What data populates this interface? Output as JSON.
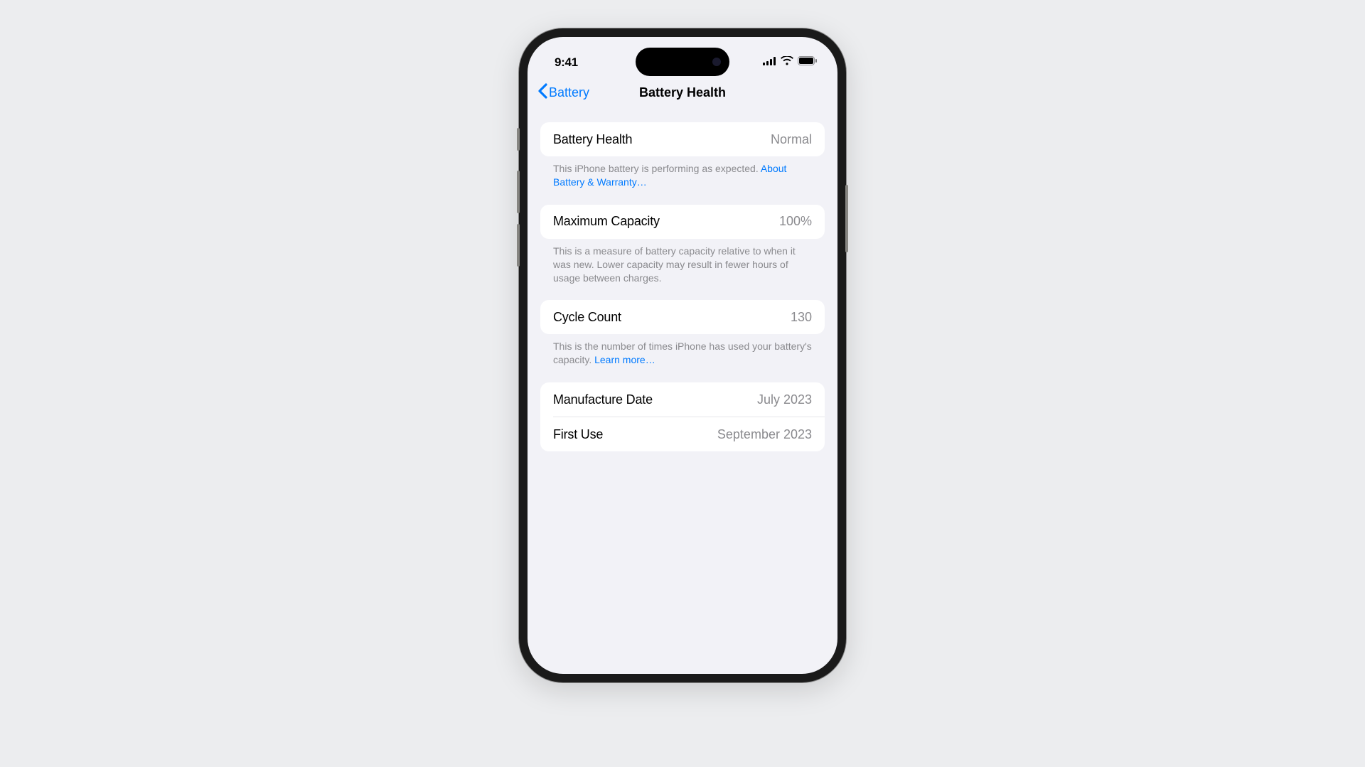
{
  "status": {
    "time": "9:41"
  },
  "nav": {
    "back_label": "Battery",
    "title": "Battery Health"
  },
  "sections": {
    "health": {
      "label": "Battery Health",
      "value": "Normal",
      "footer_pre": "This iPhone battery is performing as expected. ",
      "footer_link": "About Battery & Warranty…"
    },
    "capacity": {
      "label": "Maximum Capacity",
      "value": "100%",
      "footer": "This is a measure of battery capacity relative to when it was new. Lower capacity may result in fewer hours of usage between charges."
    },
    "cycle": {
      "label": "Cycle Count",
      "value": "130",
      "footer_pre": "This is the number of times iPhone has used your battery's capacity. ",
      "footer_link": "Learn more…"
    },
    "dates": {
      "manufacture_label": "Manufacture Date",
      "manufacture_value": "July 2023",
      "firstuse_label": "First Use",
      "firstuse_value": "September 2023"
    }
  }
}
